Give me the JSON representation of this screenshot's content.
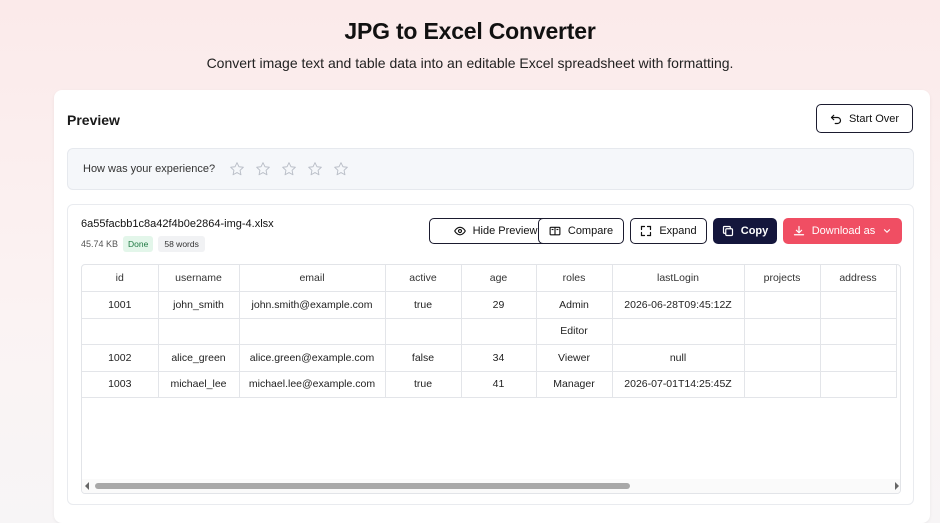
{
  "header": {
    "title": "JPG to Excel Converter",
    "subtitle": "Convert image text and table data into an editable Excel spreadsheet with formatting."
  },
  "preview": {
    "heading": "Preview",
    "start_over_label": "Start Over"
  },
  "feedback": {
    "question": "How was your experience?",
    "stars": 5
  },
  "result": {
    "filename": "6a55facbb1c8a42f4b0e2864-img-4.xlsx",
    "size": "45.74 KB",
    "status": "Done",
    "words": "58 words",
    "buttons": {
      "hide_preview": "Hide Preview",
      "compare": "Compare",
      "expand": "Expand",
      "copy": "Copy",
      "download": "Download as"
    }
  },
  "table": {
    "columns": [
      "id",
      "username",
      "email",
      "active",
      "age",
      "roles",
      "lastLogin",
      "projects",
      "address"
    ],
    "rows": [
      [
        "1001",
        "john_smith",
        "john.smith@example.com",
        "true",
        "29",
        "Admin",
        "2026-06-28T09:45:12Z",
        "",
        ""
      ],
      [
        "",
        "",
        "",
        "",
        "",
        "Editor",
        "",
        "",
        ""
      ],
      [
        "1002",
        "alice_green",
        "alice.green@example.com",
        "false",
        "34",
        "Viewer",
        "null",
        "",
        ""
      ],
      [
        "1003",
        "michael_lee",
        "michael.lee@example.com",
        "true",
        "41",
        "Manager",
        "2026-07-01T14:25:45Z",
        "",
        ""
      ]
    ]
  },
  "colors": {
    "copy_button": "#14163c",
    "download_button": "#f04e63",
    "done_badge": "#1f7a43"
  }
}
